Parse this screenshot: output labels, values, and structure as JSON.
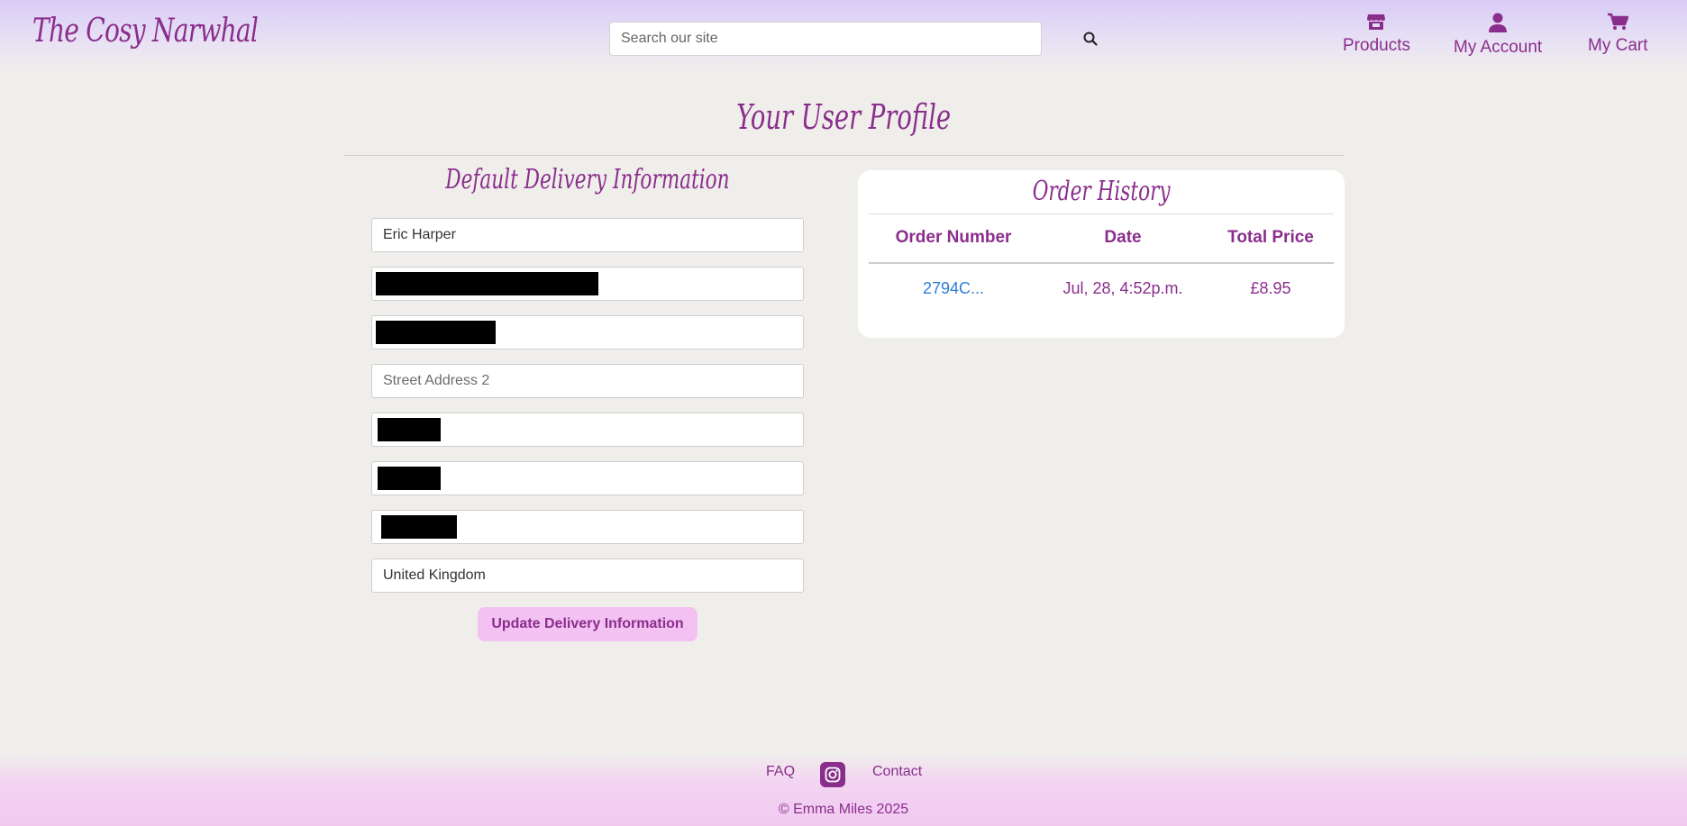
{
  "header": {
    "logo": "The Cosy Narwhal",
    "search_placeholder": "Search our site",
    "nav": {
      "products": "Products",
      "account": "My Account",
      "cart": "My Cart"
    }
  },
  "page": {
    "title": "Your User Profile"
  },
  "delivery": {
    "heading": "Default Delivery Information",
    "full_name": "Eric Harper",
    "street_address_2_placeholder": "Street Address 2",
    "country": "United Kingdom",
    "update_button": "Update Delivery Information"
  },
  "orders": {
    "heading": "Order History",
    "columns": [
      "Order Number",
      "Date",
      "Total Price"
    ],
    "rows": [
      {
        "number": "2794C...",
        "date": "Jul, 28, 4:52p.m.",
        "total": "£8.95"
      }
    ]
  },
  "footer": {
    "faq": "FAQ",
    "contact": "Contact",
    "copyright": "© Emma Miles 2025"
  },
  "icons": {
    "brand_color": "#8a2e8c",
    "link_color": "#2f7fd6",
    "button_bg": "#f3c1f2",
    "products": "store-icon",
    "account": "user-icon",
    "cart": "cart-icon",
    "search": "search-icon",
    "social": "instagram-icon"
  }
}
